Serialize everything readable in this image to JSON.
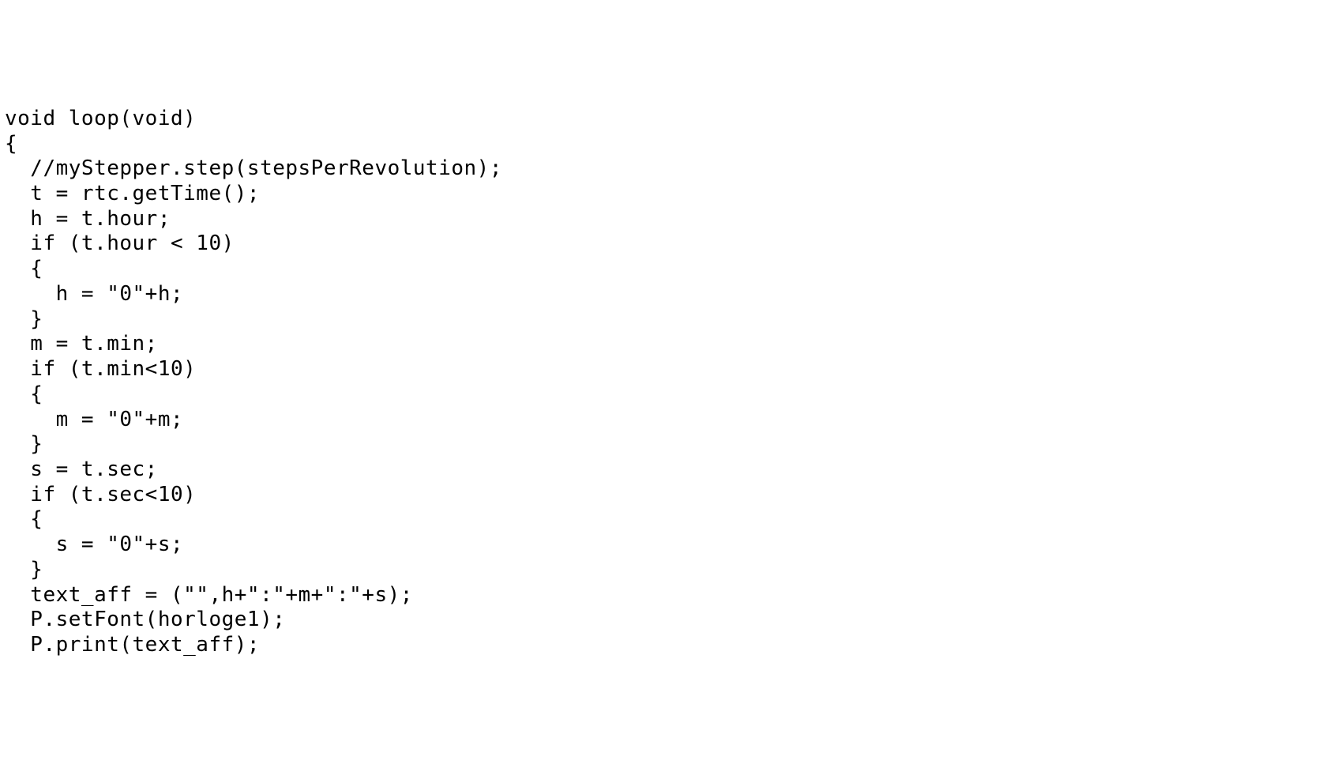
{
  "code": {
    "lines": [
      "void loop(void)",
      "{",
      "  //myStepper.step(stepsPerRevolution);",
      "  t = rtc.getTime();",
      "  h = t.hour;",
      "  if (t.hour < 10)",
      "  {",
      "    h = \"0\"+h;",
      "  }",
      "  m = t.min;",
      "  if (t.min<10)",
      "  {",
      "    m = \"0\"+m;",
      "  }",
      "  s = t.sec;",
      "  if (t.sec<10)",
      "  {",
      "    s = \"0\"+s;",
      "  }",
      "",
      "  text_aff = (\"\",h+\":\"+m+\":\"+s);",
      "",
      "",
      "",
      "  P.setFont(horloge1);",
      "  P.print(text_aff);"
    ]
  }
}
